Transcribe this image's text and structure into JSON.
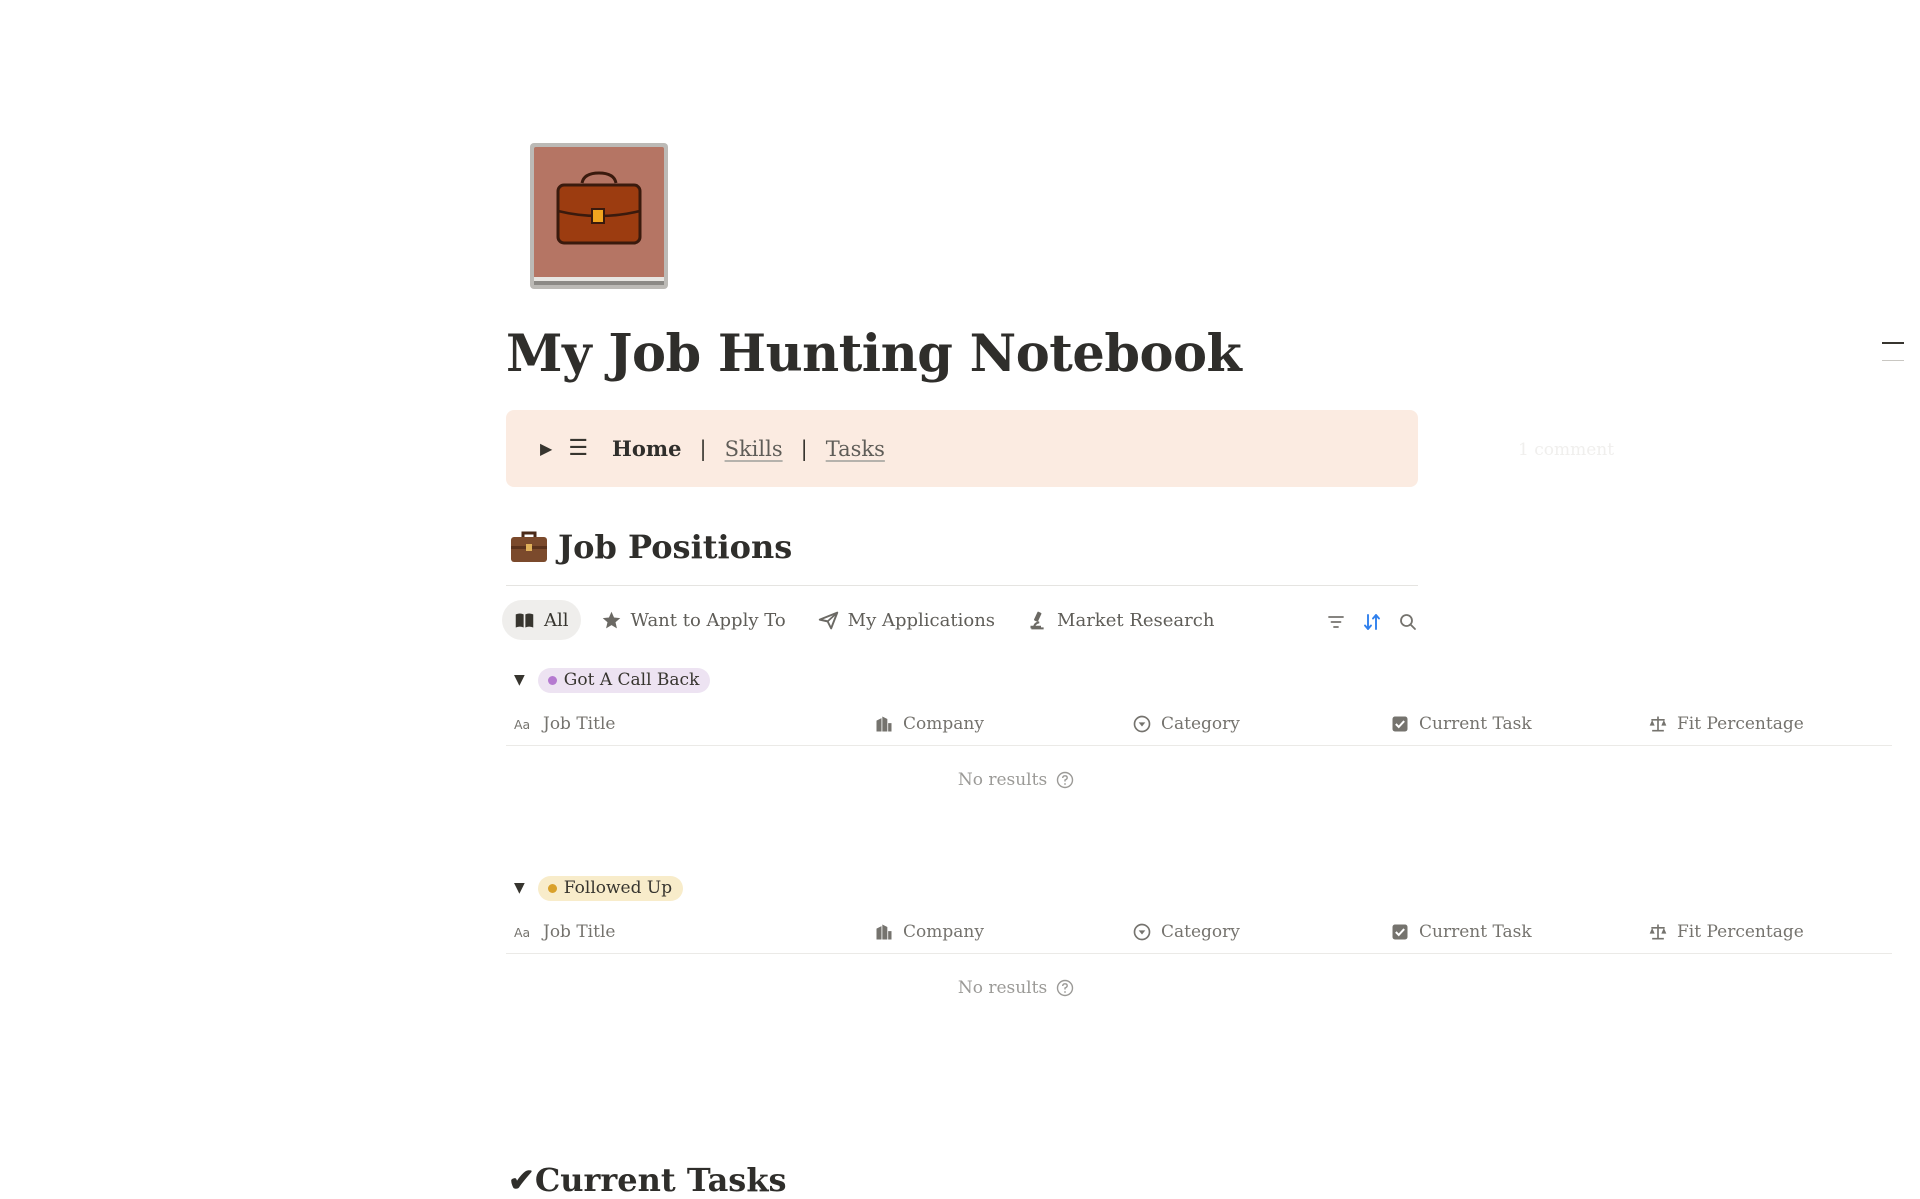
{
  "page": {
    "title": "My Job Hunting Notebook",
    "icon": "briefcase-notebook-icon"
  },
  "nav": {
    "home": "Home",
    "separator": "|",
    "skills": "Skills",
    "tasks": "Tasks"
  },
  "comment_hint": "1 comment",
  "job_positions": {
    "heading": "Job Positions",
    "tabs": [
      {
        "label": "All",
        "icon": "book-icon",
        "active": true
      },
      {
        "label": "Want to Apply To",
        "icon": "star-icon",
        "active": false
      },
      {
        "label": "My Applications",
        "icon": "paper-plane-icon",
        "active": false
      },
      {
        "label": "Market Research",
        "icon": "microscope-icon",
        "active": false
      }
    ],
    "columns": [
      {
        "label": "Job Title",
        "icon": "text-icon"
      },
      {
        "label": "Company",
        "icon": "building-icon"
      },
      {
        "label": "Category",
        "icon": "select-icon"
      },
      {
        "label": "Current Task",
        "icon": "checkbox-icon"
      },
      {
        "label": "Fit Percentage",
        "icon": "scale-icon"
      }
    ],
    "groups": [
      {
        "label": "Got A Call Back",
        "bg": "#ede3f2",
        "dot": "#b57ad0",
        "empty_text": "No results"
      },
      {
        "label": "Followed Up",
        "bg": "#f8ecca",
        "dot": "#d9a12b",
        "empty_text": "No results"
      }
    ]
  },
  "current_tasks": {
    "heading": "✔Current Tasks"
  },
  "colors": {
    "callout_bg": "#fbebe1",
    "accent_sort": "#2f80ed"
  }
}
